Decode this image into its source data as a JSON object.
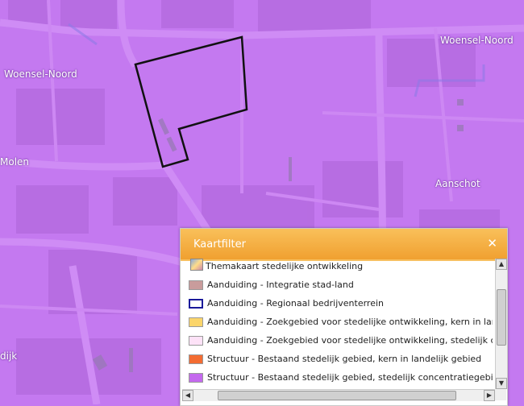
{
  "map": {
    "labels": {
      "woensel_noord_left": "Woensel-Noord",
      "woensel_noord_right": "Woensel-Noord",
      "molen": "Molen",
      "aanschot": "Aanschot",
      "partial_bottom_left": "dijk"
    },
    "colors": {
      "base": "#c479f0",
      "road": "#cf8cf5",
      "block": "#ad64d8",
      "boundary": "#111111",
      "water": "#8f7ae6"
    }
  },
  "kaartfilter": {
    "title": "Kaartfilter",
    "close_icon": "close-icon",
    "theme_label": "Themakaart stedelijke ontwikkeling",
    "items": [
      {
        "label": "Aanduiding - Integratie stad-land",
        "color": "#c99c9c"
      },
      {
        "label": "Aanduiding - Regionaal bedrijventerrein",
        "color": "#1a1a9a"
      },
      {
        "label": "Aanduiding - Zoekgebied voor stedelijke ontwikkeling, kern in landelijk g",
        "color": "#fbd56b"
      },
      {
        "label": "Aanduiding - Zoekgebied voor stedelijke ontwikkeling, stedelijk concent",
        "color": "#fde2f7"
      },
      {
        "label": "Structuur - Bestaand stedelijk gebied, kern in landelijk gebied",
        "color": "#f36c32"
      },
      {
        "label": "Structuur - Bestaand stedelijk gebied, stedelijk concentratiegebied",
        "color": "#c469ee"
      }
    ],
    "scroll": {
      "up": "▲",
      "down": "▼",
      "left": "◀",
      "right": "▶"
    }
  }
}
